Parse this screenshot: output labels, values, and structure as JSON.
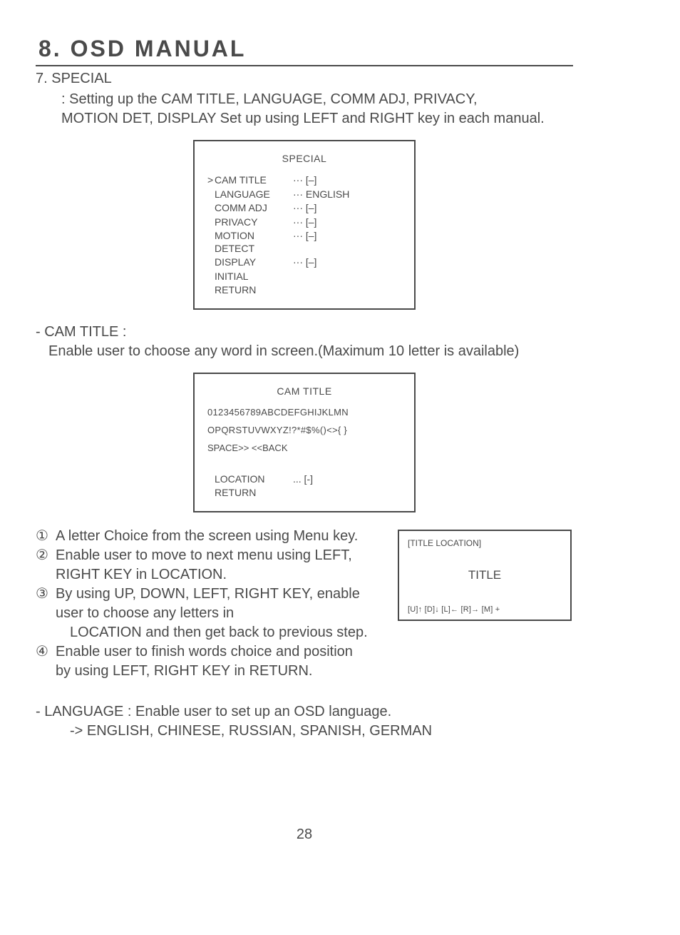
{
  "header": {
    "title": "8. OSD MANUAL"
  },
  "section": {
    "number_title": "7. SPECIAL",
    "desc_line1": ": Setting up the CAM TITLE, LANGUAGE, COMM ADJ, PRIVACY,",
    "desc_line2": "MOTION DET, DISPLAY Set up using LEFT and RIGHT key in each manual."
  },
  "special_box": {
    "title": "SPECIAL",
    "rows": [
      {
        "cursor": ">",
        "label": "CAM TITLE",
        "val": "··· [–]"
      },
      {
        "cursor": "",
        "label": "LANGUAGE",
        "val": "··· ENGLISH"
      },
      {
        "cursor": "",
        "label": "COMM ADJ",
        "val": "··· [–]"
      },
      {
        "cursor": "",
        "label": "PRIVACY",
        "val": "··· [–]"
      },
      {
        "cursor": "",
        "label": "MOTION DETECT",
        "val": "··· [–]"
      },
      {
        "cursor": "",
        "label": "DISPLAY",
        "val": "··· [–]"
      },
      {
        "cursor": "",
        "label": "INITIAL",
        "val": ""
      },
      {
        "cursor": "",
        "label": "RETURN",
        "val": ""
      }
    ]
  },
  "camtitle": {
    "head": "- CAM TITLE :",
    "desc": "Enable user to choose any word in screen.(Maximum 10 letter is available)"
  },
  "camtitle_box": {
    "title": "CAM TITLE",
    "chars_line1": "0123456789ABCDEFGHIJKLMN",
    "chars_line2": "OPQRSTUVWXYZ!?*#$%()<>{ }",
    "spaceback": "SPACE>>   <<BACK",
    "loc_label": "LOCATION",
    "loc_val": "... [-]",
    "return": "RETURN"
  },
  "steps": [
    {
      "num": "①",
      "text": "A letter Choice from the screen using Menu key."
    },
    {
      "num": "②",
      "text": "Enable user to move to next menu using LEFT, RIGHT KEY in LOCATION."
    },
    {
      "num": "③",
      "text": "By using UP, DOWN, LEFT, RIGHT KEY, enable user to choose any letters in",
      "cont": "LOCATION and then get back to previous step."
    },
    {
      "num": "④",
      "text": "Enable user to finish words choice and position",
      "cont2": "by using LEFT, RIGHT KEY in RETURN."
    }
  ],
  "title_location_box": {
    "head": "[TITLE LOCATION]",
    "title": "TITLE",
    "keys": "[U]↑ [D]↓ [L]← [R]→ [M] +"
  },
  "language": {
    "head": "- LANGUAGE : Enable user to set up an OSD language.",
    "sub": "-> ENGLISH, CHINESE, RUSSIAN, SPANISH, GERMAN"
  },
  "page": {
    "number": "28"
  }
}
